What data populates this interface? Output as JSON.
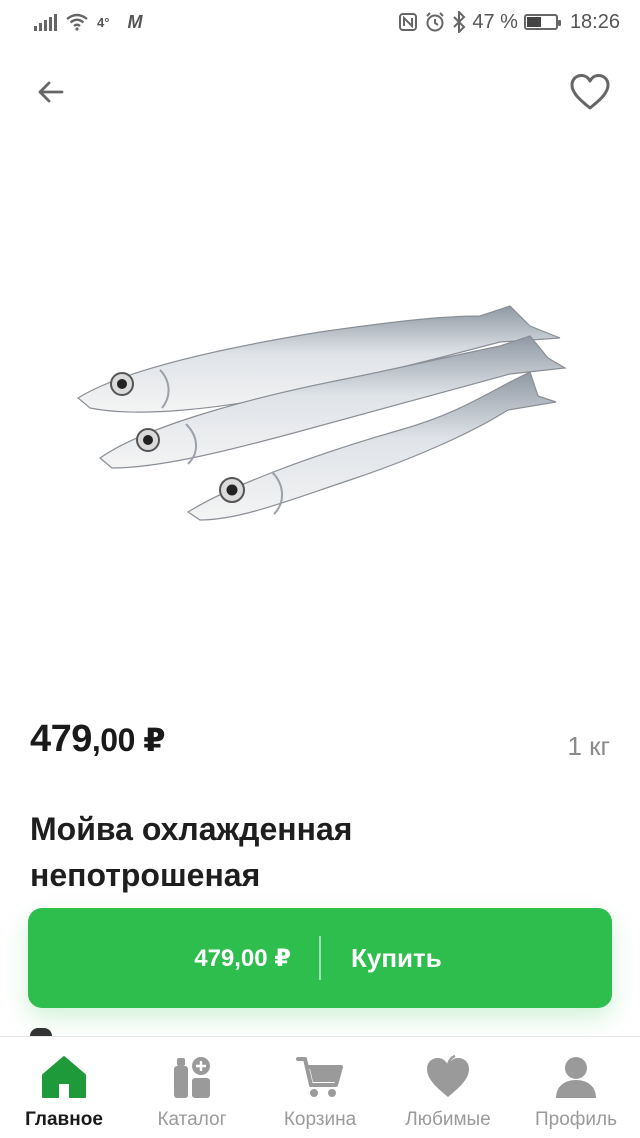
{
  "status_bar": {
    "network": "4°",
    "carrier_mark": "M",
    "battery": "47 %",
    "battery_level": 0.47,
    "time": "18:26"
  },
  "header": {
    "back_icon": "arrow-left-icon",
    "favorite_icon": "heart-outline-icon"
  },
  "product": {
    "image_icon": "capelin-fish-image",
    "price_main": "479",
    "price_cents": ",00 ₽",
    "weight": "1 кг",
    "title": "Мойва охлажденная непотрошеная"
  },
  "buy_button": {
    "price": "479,00 ₽",
    "label": "Купить"
  },
  "nav": {
    "items": [
      {
        "label": "Главное",
        "icon": "home-icon",
        "active": true
      },
      {
        "label": "Каталог",
        "icon": "catalog-icon",
        "active": false
      },
      {
        "label": "Корзина",
        "icon": "cart-icon",
        "active": false
      },
      {
        "label": "Любимые",
        "icon": "heart-icon",
        "active": false
      },
      {
        "label": "Профиль",
        "icon": "profile-icon",
        "active": false
      }
    ]
  },
  "colors": {
    "accent": "#2dbe4e",
    "nav_active_icon": "#1f9a3b",
    "nav_inactive_icon": "#9a9a9a"
  }
}
